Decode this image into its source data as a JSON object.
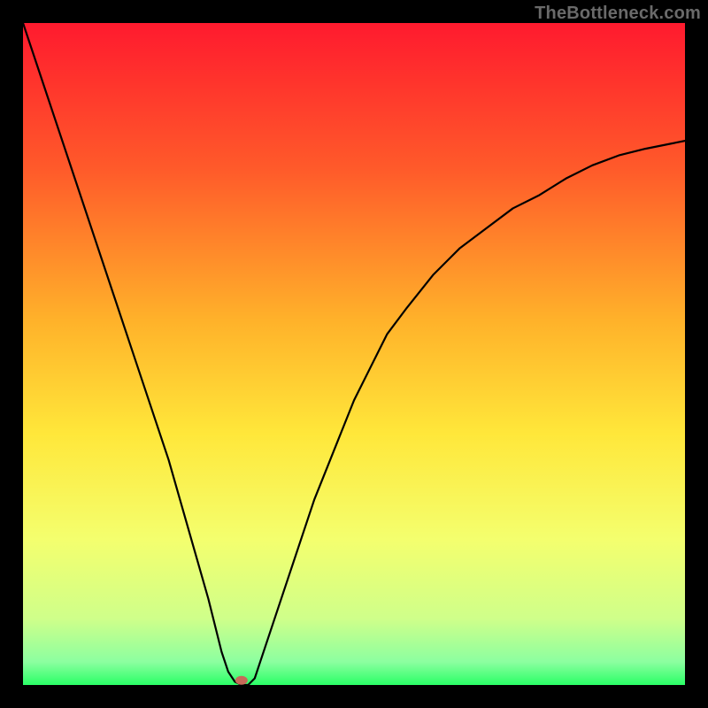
{
  "watermark": "TheBottleneck.com",
  "chart_data": {
    "type": "line",
    "title": "",
    "xlabel": "",
    "ylabel": "",
    "xlim": [
      0,
      100
    ],
    "ylim": [
      0,
      100
    ],
    "grid": false,
    "legend": false,
    "background_gradient_stops": [
      {
        "offset": 0,
        "color": "#ff1a2e"
      },
      {
        "offset": 0.22,
        "color": "#ff5a2a"
      },
      {
        "offset": 0.45,
        "color": "#ffb22a"
      },
      {
        "offset": 0.62,
        "color": "#ffe73a"
      },
      {
        "offset": 0.78,
        "color": "#f4ff6e"
      },
      {
        "offset": 0.9,
        "color": "#cfff8a"
      },
      {
        "offset": 0.965,
        "color": "#8cffa0"
      },
      {
        "offset": 1.0,
        "color": "#2aff66"
      }
    ],
    "series": [
      {
        "name": "bottleneck-curve",
        "color": "#000000",
        "stroke_width": 2.2,
        "x": [
          0,
          2,
          4,
          6,
          8,
          10,
          12,
          14,
          16,
          18,
          20,
          22,
          24,
          26,
          28,
          30,
          31,
          32,
          33,
          34,
          35,
          36,
          38,
          40,
          42,
          44,
          46,
          48,
          50,
          52,
          55,
          58,
          62,
          66,
          70,
          74,
          78,
          82,
          86,
          90,
          94,
          98,
          100
        ],
        "y": [
          100,
          94,
          88,
          82,
          76,
          70,
          64,
          58,
          52,
          46,
          40,
          34,
          27,
          20,
          13,
          5,
          2,
          0.5,
          0,
          0,
          1,
          4,
          10,
          16,
          22,
          28,
          33,
          38,
          43,
          47,
          53,
          57,
          62,
          66,
          69,
          72,
          74,
          76.5,
          78.5,
          80,
          81,
          81.8,
          82.2
        ]
      }
    ],
    "marker": {
      "name": "min-point-marker",
      "x": 33,
      "y": 0.7,
      "rx": 7,
      "ry": 5,
      "fill": "#c76a59"
    }
  }
}
